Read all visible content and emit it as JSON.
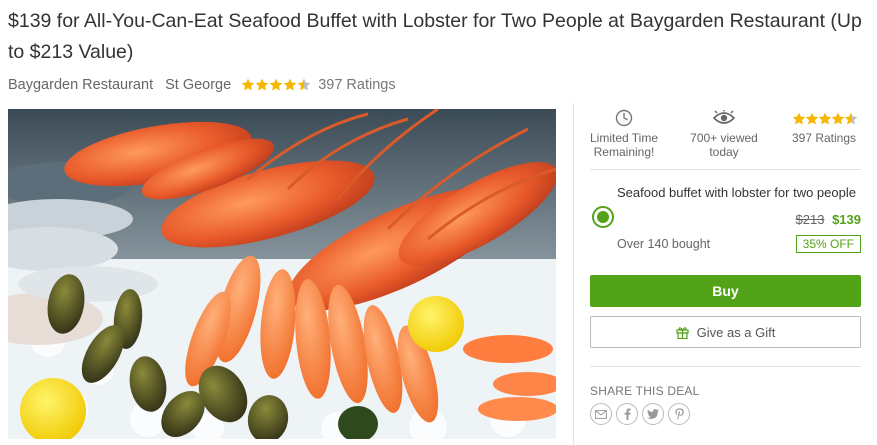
{
  "deal": {
    "title": "$139 for All-You-Can-Eat Seafood Buffet with Lobster for Two People at Baygarden Restaurant (Up to $213 Value)",
    "merchant": "Baygarden Restaurant",
    "location": "St George",
    "rating": 4.5,
    "ratings_label": "397 Ratings"
  },
  "photo": {
    "icon": "seafood-buffet-photo"
  },
  "badges": [
    {
      "icon": "clock-icon",
      "line1": "Limited Time",
      "line2": "Remaining!"
    },
    {
      "icon": "eye-icon",
      "line1": "700+ viewed",
      "line2": "today"
    },
    {
      "icon": "star-rating",
      "line1": "397 Ratings",
      "line2": ""
    }
  ],
  "option": {
    "title": "Seafood buffet with lobster for two people",
    "old_price": "$213",
    "new_price": "$139",
    "bought": "Over 140 bought",
    "discount": "35% OFF"
  },
  "actions": {
    "buy_label": "Buy",
    "gift_label": "Give as a Gift"
  },
  "share": {
    "label": "SHARE THIS DEAL",
    "icons": [
      "email-icon",
      "facebook-icon",
      "twitter-icon",
      "pinterest-icon"
    ]
  },
  "colors": {
    "accent_green": "#53a318",
    "star_gold": "#f5b700",
    "text_dark": "#333333",
    "text_muted": "#666666"
  }
}
